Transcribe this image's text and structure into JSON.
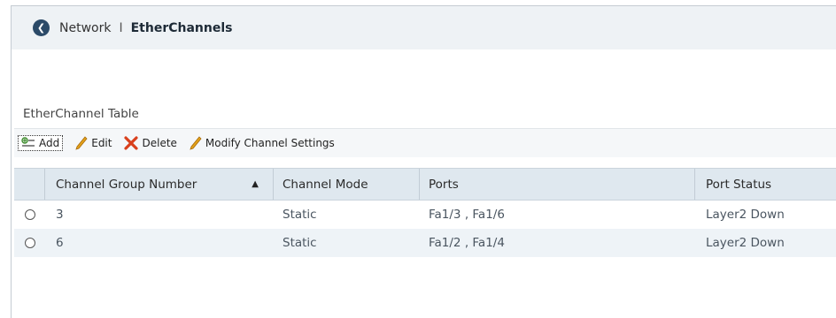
{
  "header": {
    "parent": "Network",
    "separator": "I",
    "current": "EtherChannels"
  },
  "table_title": "EtherChannel Table",
  "toolbar": {
    "add_label": "Add",
    "edit_label": "Edit",
    "delete_label": "Delete",
    "modify_label": "Modify Channel Settings"
  },
  "columns": {
    "channel_group": "Channel Group Number",
    "channel_mode": "Channel Mode",
    "ports": "Ports",
    "port_status": "Port Status"
  },
  "rows": [
    {
      "group": "3",
      "mode": "Static",
      "ports": "Fa1/3 , Fa1/6",
      "status": "Layer2 Down"
    },
    {
      "group": "6",
      "mode": "Static",
      "ports": "Fa1/2 , Fa1/4",
      "status": "Layer2 Down"
    }
  ],
  "colors": {
    "header_bg": "#eef2f5",
    "grid_header_bg": "#dfe8ef",
    "alt_row_bg": "#eef3f7",
    "delete_icon": "#d9401d",
    "pencil_icon": "#e3a21a",
    "back_button": "#2b4a68"
  }
}
